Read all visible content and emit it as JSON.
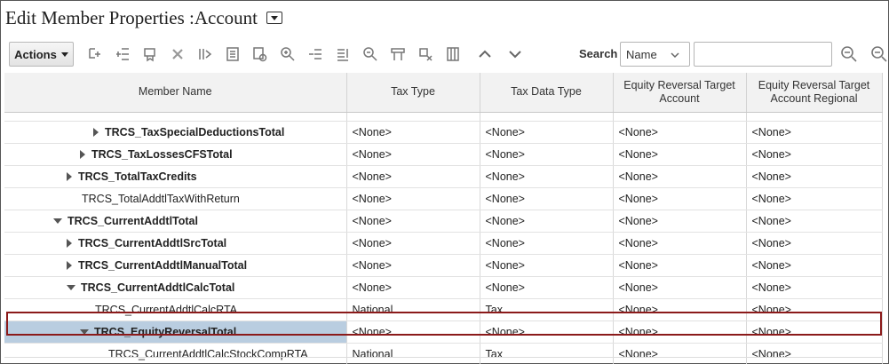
{
  "window": {
    "title": "Edit Member Properties :Account"
  },
  "toolbar": {
    "actions_label": "Actions",
    "icons": [
      "add-child-icon",
      "add-sibling-icon",
      "edit-member-icon",
      "delete-icon",
      "move-icon",
      "shared-member-icon",
      "refresh-icon",
      "zoom-in-icon",
      "indent-icon",
      "outdent-icon",
      "zoom-out-icon",
      "assign-icon",
      "remove-icon",
      "grid-icon",
      "move-up-icon",
      "move-down-icon"
    ],
    "search_label": "Search",
    "search_field_value": "Name",
    "search_input_value": ""
  },
  "grid": {
    "columns": [
      {
        "label": "Member Name"
      },
      {
        "label": "Tax Type"
      },
      {
        "label": "Tax Data Type"
      },
      {
        "label": "Equity Reversal Target Account"
      },
      {
        "label": "Equity Reversal Target Account Regional"
      }
    ],
    "rows": [
      {
        "name": "TRCS_TaxSpecialDeductionsTotal",
        "bold": true,
        "expander": "collapsed",
        "indent": 3,
        "tax_type": "<None>",
        "tax_data_type": "<None>",
        "ert_account": "<None>",
        "ert_regional": "<None>"
      },
      {
        "name": "TRCS_TaxLossesCFSTotal",
        "bold": true,
        "expander": "collapsed",
        "indent": 2,
        "tax_type": "<None>",
        "tax_data_type": "<None>",
        "ert_account": "<None>",
        "ert_regional": "<None>"
      },
      {
        "name": "TRCS_TotalTaxCredits",
        "bold": true,
        "expander": "collapsed",
        "indent": 1,
        "tax_type": "<None>",
        "tax_data_type": "<None>",
        "ert_account": "<None>",
        "ert_regional": "<None>"
      },
      {
        "name": "TRCS_TotalAddtlTaxWithReturn",
        "bold": false,
        "expander": "none",
        "indent": 1,
        "tax_type": "<None>",
        "tax_data_type": "<None>",
        "ert_account": "<None>",
        "ert_regional": "<None>"
      },
      {
        "name": "TRCS_CurrentAddtlTotal",
        "bold": true,
        "expander": "expanded",
        "indent": 0,
        "tax_type": "<None>",
        "tax_data_type": "<None>",
        "ert_account": "<None>",
        "ert_regional": "<None>"
      },
      {
        "name": "TRCS_CurrentAddtlSrcTotal",
        "bold": true,
        "expander": "collapsed",
        "indent": 1,
        "tax_type": "<None>",
        "tax_data_type": "<None>",
        "ert_account": "<None>",
        "ert_regional": "<None>"
      },
      {
        "name": "TRCS_CurrentAddtlManualTotal",
        "bold": true,
        "expander": "collapsed",
        "indent": 1,
        "tax_type": "<None>",
        "tax_data_type": "<None>",
        "ert_account": "<None>",
        "ert_regional": "<None>"
      },
      {
        "name": "TRCS_CurrentAddtlCalcTotal",
        "bold": true,
        "expander": "expanded",
        "indent": 1,
        "tax_type": "<None>",
        "tax_data_type": "<None>",
        "ert_account": "<None>",
        "ert_regional": "<None>"
      },
      {
        "name": "TRCS_CurrentAddtlCalcRTA",
        "bold": false,
        "expander": "none",
        "indent": 2,
        "tax_type": "National",
        "tax_data_type": "Tax",
        "ert_account": "<None>",
        "ert_regional": "<None>"
      },
      {
        "name": "TRCS_EquityReversalTotal",
        "bold": true,
        "expander": "expanded",
        "indent": 2,
        "selected": true,
        "tax_type": "<None>",
        "tax_data_type": "<None>",
        "ert_account": "<None>",
        "ert_regional": "<None>"
      },
      {
        "name": "TRCS_CurrentAddtlCalcStockCompRTA",
        "bold": false,
        "expander": "none",
        "indent": 3,
        "tax_type": "National",
        "tax_data_type": "Tax",
        "ert_account": "<None>",
        "ert_regional": "<None>"
      }
    ]
  }
}
